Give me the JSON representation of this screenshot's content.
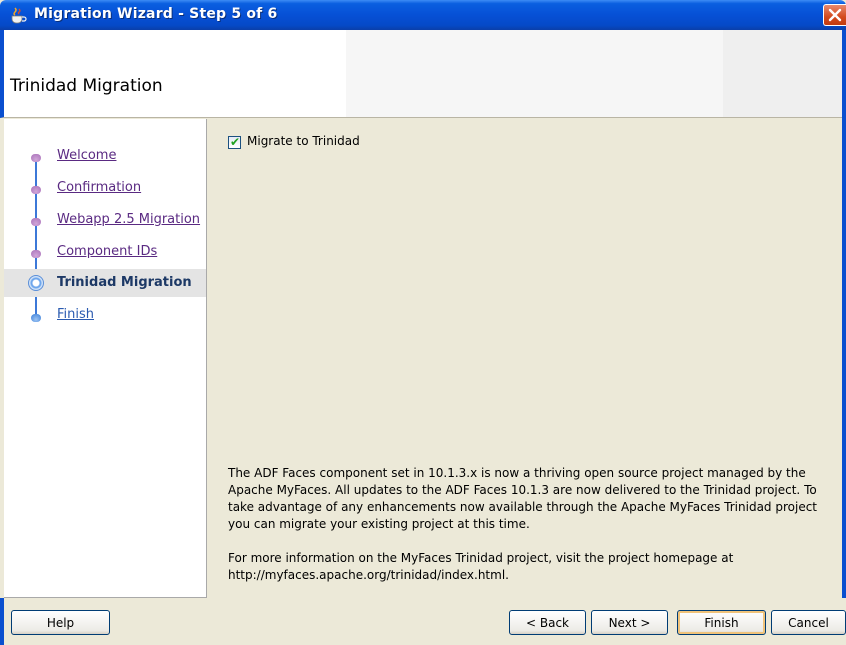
{
  "window": {
    "title": "Migration Wizard - Step 5 of 6"
  },
  "header": {
    "title": "Trinidad Migration"
  },
  "nav": {
    "items": [
      {
        "label": "Welcome",
        "state": "visited"
      },
      {
        "label": "Confirmation",
        "state": "visited"
      },
      {
        "label": "Webapp 2.5 Migration",
        "state": "visited"
      },
      {
        "label": "Component IDs",
        "state": "visited"
      },
      {
        "label": "Trinidad Migration",
        "state": "current"
      },
      {
        "label": "Finish",
        "state": "upcoming"
      }
    ]
  },
  "content": {
    "checkbox": {
      "label": "Migrate to Trinidad",
      "checked": true
    },
    "info_paragraph_1": "The ADF Faces component set in 10.1.3.x is now a thriving open source project managed by the Apache MyFaces. All updates to the ADF Faces 10.1.3 are now delivered to the Trinidad project. To take advantage of any enhancements now available through the Apache MyFaces Trinidad project you can migrate your existing project at this time.",
    "info_paragraph_2": "For more information on the MyFaces Trinidad project, visit the project homepage at http://myfaces.apache.org/trinidad/index.html."
  },
  "buttons": {
    "help": "Help",
    "back": "< Back",
    "next": "Next >",
    "finish": "Finish",
    "cancel": "Cancel"
  },
  "colors": {
    "titlebar": "#0650d6",
    "visited_link": "#5a2a82",
    "current_step": "#1d3966",
    "dialog_bg": "#ece9d8"
  }
}
